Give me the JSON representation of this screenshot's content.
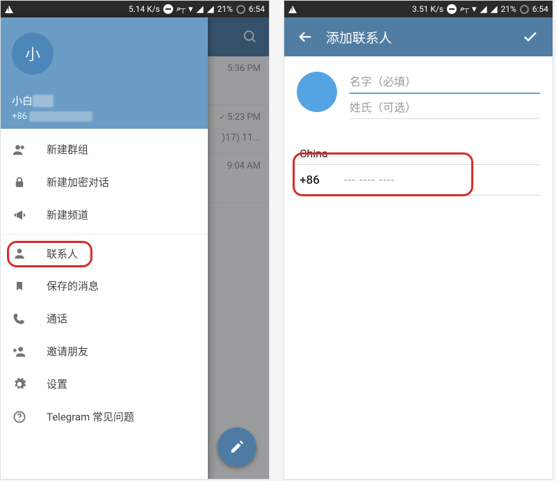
{
  "statusbar": {
    "left_speed": "5.14 K/s",
    "right_speed": "3.51 K/s",
    "battery": "21%",
    "time": "6:54"
  },
  "left": {
    "drawer": {
      "avatar_letter": "小",
      "username_visible": "小白",
      "phone_visible": "+86",
      "items": [
        {
          "label": "新建群组"
        },
        {
          "label": "新建加密对话"
        },
        {
          "label": "新建频道"
        },
        {
          "label": "联系人"
        },
        {
          "label": "保存的消息"
        },
        {
          "label": "通话"
        },
        {
          "label": "邀请朋友"
        },
        {
          "label": "设置"
        },
        {
          "label": "Telegram 常见问题"
        }
      ]
    },
    "chats": [
      {
        "time": "5:36 PM",
        "sub": ""
      },
      {
        "time": "5:23 PM",
        "sub": ")17) 11...",
        "sent": true
      },
      {
        "time": "9:04 AM",
        "sub": ""
      }
    ]
  },
  "right": {
    "title": "添加联系人",
    "first_name_placeholder": "名字（必填）",
    "last_name_placeholder": "姓氏（可选）",
    "country": "China",
    "country_code": "+86",
    "phone_placeholder": "--- ---- ----"
  }
}
